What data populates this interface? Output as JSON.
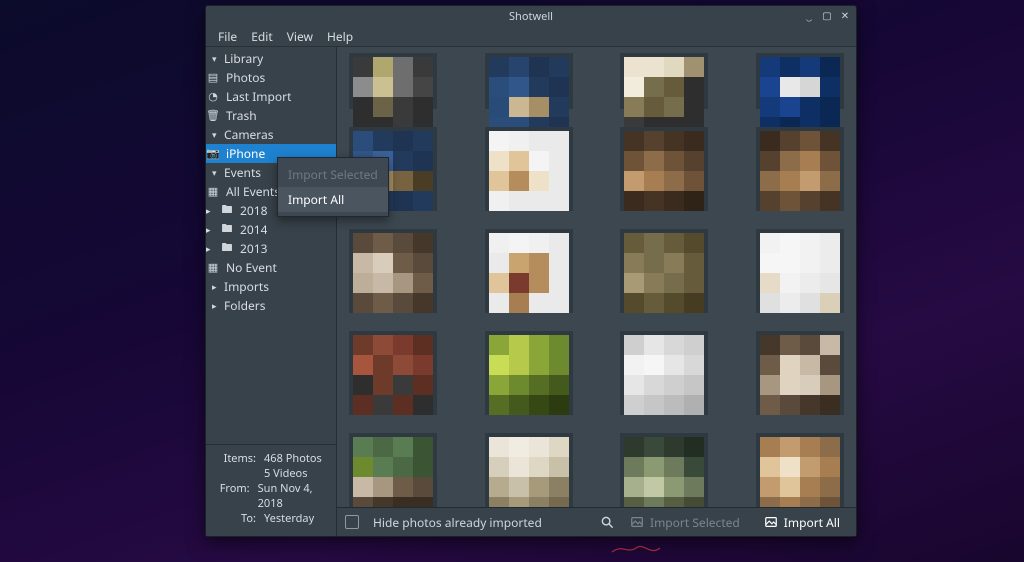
{
  "window": {
    "title": "Shotwell"
  },
  "menus": {
    "file": "File",
    "edit": "Edit",
    "view": "View",
    "help": "Help"
  },
  "tree": {
    "library": {
      "label": "Library",
      "photos": "Photos",
      "last_import": "Last Import",
      "trash": "Trash"
    },
    "cameras": {
      "label": "Cameras",
      "iphone": "iPhone"
    },
    "events": {
      "label": "Events",
      "all": "All Events",
      "y2018": "2018",
      "y2014": "2014",
      "y2013": "2013",
      "noevent": "No Event"
    },
    "imports": {
      "label": "Imports"
    },
    "folders": {
      "label": "Folders"
    }
  },
  "info": {
    "items_label": "Items:",
    "photos": "468 Photos",
    "videos": "5 Videos",
    "from_label": "From:",
    "from_value": "Sun Nov 4, 2018",
    "to_label": "To:",
    "to_value": "Yesterday"
  },
  "bottombar": {
    "hide_label": "Hide photos already imported",
    "import_selected": "Import Selected",
    "import_all": "Import All"
  },
  "context_menu": {
    "import_selected": "Import Selected",
    "import_all": "Import All"
  },
  "thumbs": [
    [
      [
        "#3a3a3a",
        "#b0a76f",
        "#6e6e6e",
        "#3a3a3a",
        "#8c8c8c",
        "#cac092",
        "#6e6e6e",
        "#454545",
        "#2e2e2e",
        "#6b6348",
        "#3a3a3a",
        "#2e2e2e",
        "#2e2e2e",
        "#2e2e2e",
        "#3a3a3a",
        "#2e2e2e"
      ],
      [
        "#223a5c",
        "#27446e",
        "#1e3452",
        "#223a5c",
        "#2a4d7c",
        "#315689",
        "#223a5c",
        "#1e3452",
        "#284b78",
        "#cbb792",
        "#a68f65",
        "#223a5c",
        "#2a4d7c",
        "#2a4d7c",
        "#223a5c",
        "#1e3452"
      ],
      [
        "#ebe3d0",
        "#ebe3d0",
        "#e1d8c0",
        "#a09270",
        "#f2ecdd",
        "#766d4c",
        "#665c3b",
        "#2e2e2e",
        "#887b58",
        "#665c3b",
        "#766d4c",
        "#2e2e2e",
        "#3a3a3a",
        "#2e2e2e",
        "#2e2e2e",
        "#2e2e2e"
      ],
      [
        "#153a7a",
        "#0e2f64",
        "#153a7a",
        "#0b2854",
        "#1a4490",
        "#e8e8e8",
        "#d6d6d6",
        "#0e2f64",
        "#153a7a",
        "#1a4490",
        "#0e2f64",
        "#0b2854",
        "#0e2f64",
        "#0b2854",
        "#0e2f64",
        "#0b2854"
      ]
    ],
    [
      [
        "#2a4d7c",
        "#223a5c",
        "#1e3452",
        "#223a5c",
        "#315689",
        "#3b629a",
        "#223a5c",
        "#1e3452",
        "#bfa976",
        "#a68f65",
        "#77633f",
        "#4a3d26",
        "#2a4d7c",
        "#223a5c",
        "#1e3452",
        "#223a5c"
      ],
      [
        "#f4f4f4",
        "#f0f0f0",
        "#eaeaea",
        "#eaeaea",
        "#efe1c8",
        "#e0c49a",
        "#f4f4f4",
        "#eaeaea",
        "#e0c49a",
        "#b58d5c",
        "#efe1c8",
        "#eaeaea",
        "#f0f0f0",
        "#eaeaea",
        "#eaeaea",
        "#eaeaea"
      ],
      [
        "#453324",
        "#56412e",
        "#453324",
        "#3a2b1e",
        "#6e5338",
        "#8d6c4a",
        "#6e5338",
        "#56412e",
        "#c29c6e",
        "#a67e52",
        "#8d6c4a",
        "#6e5338",
        "#3a2b1e",
        "#453324",
        "#3a2b1e",
        "#2f2318"
      ],
      [
        "#3a2b1e",
        "#56412e",
        "#6e5338",
        "#453324",
        "#56412e",
        "#8d6c4a",
        "#a67e52",
        "#6e5338",
        "#8d6c4a",
        "#a67e52",
        "#c29c6e",
        "#8d6c4a",
        "#56412e",
        "#6e5338",
        "#56412e",
        "#453324"
      ]
    ],
    [
      [
        "#5a4a3b",
        "#6e5b48",
        "#5a4a3b",
        "#453729",
        "#c7b9a6",
        "#d8ccba",
        "#6e5b48",
        "#5a4a3b",
        "#bdae99",
        "#c7b9a6",
        "#a79781",
        "#6e5b48",
        "#5a4a3b",
        "#6e5b48",
        "#5a4a3b",
        "#453729"
      ],
      [
        "#f0f0f0",
        "#f4f4f4",
        "#f0f0f0",
        "#eaeaea",
        "#eaeaea",
        "#c9a46e",
        "#b58d5c",
        "#eaeaea",
        "#e0c49a",
        "#7a3a2e",
        "#b58d5c",
        "#eaeaea",
        "#eaeaea",
        "#a67e52",
        "#eaeaea",
        "#eaeaea"
      ],
      [
        "#665c3b",
        "#766d4c",
        "#665c3b",
        "#544a2c",
        "#887b58",
        "#766d4c",
        "#887b58",
        "#665c3b",
        "#a79a74",
        "#887b58",
        "#766d4c",
        "#665c3b",
        "#544a2c",
        "#665c3b",
        "#544a2c",
        "#453c22"
      ],
      [
        "#f2f2f2",
        "#f6f6f6",
        "#f2f2f2",
        "#ececec",
        "#f6f6f6",
        "#f6f6f6",
        "#f2f2f2",
        "#ececec",
        "#e6dbc6",
        "#f2f2f2",
        "#ececec",
        "#e6e6e6",
        "#e0e0e0",
        "#ececec",
        "#e0e0e0",
        "#dad0b8"
      ]
    ],
    [
      [
        "#6e3a2a",
        "#8d4a36",
        "#7a3a2e",
        "#5c2f22",
        "#a7553c",
        "#6e3a2a",
        "#8d4a36",
        "#7a3a2e",
        "#2e2e2e",
        "#6e3a2a",
        "#3a3a3a",
        "#5c2f22",
        "#5c2f22",
        "#3a3a3a",
        "#5c2f22",
        "#2e2e2e"
      ],
      [
        "#8aa639",
        "#b7c94a",
        "#8aa639",
        "#6e8a2e",
        "#c9dc56",
        "#b7c94a",
        "#8aa639",
        "#6e8a2e",
        "#8aa639",
        "#6e8a2e",
        "#556e24",
        "#445a1d",
        "#556e24",
        "#445a1d",
        "#364914",
        "#2c3b10"
      ],
      [
        "#cfcfcf",
        "#e6e6e6",
        "#d8d8d8",
        "#cfcfcf",
        "#f2f2f2",
        "#f6f6f6",
        "#e6e6e6",
        "#d8d8d8",
        "#e6e6e6",
        "#d8d8d8",
        "#cfcfcf",
        "#c6c6c6",
        "#cfcfcf",
        "#c6c6c6",
        "#bcbcbc",
        "#b0b0b0"
      ],
      [
        "#453729",
        "#6e5b48",
        "#5a4a3b",
        "#c7b9a6",
        "#6e5b48",
        "#e0d3c0",
        "#c7b9a6",
        "#5a4a3b",
        "#a79781",
        "#e0d3c0",
        "#d8ccba",
        "#a79781",
        "#6e5b48",
        "#5a4a3b",
        "#453729",
        "#3a2e22"
      ]
    ],
    [
      [
        "#5a7c52",
        "#4a6944",
        "#5a7c52",
        "#3a5434",
        "#6e8a2e",
        "#5a7c52",
        "#4a6944",
        "#3a5434",
        "#c7b9a6",
        "#a79781",
        "#6e5b48",
        "#5a4a3b",
        "#5a4a3b",
        "#453729",
        "#3a2e22",
        "#3a2e22"
      ],
      [
        "#eae5d8",
        "#f0ece1",
        "#eae5d8",
        "#ded7c4",
        "#d6cfbc",
        "#eae5d8",
        "#ded7c4",
        "#c9c0aa",
        "#b7ab8f",
        "#c9c0aa",
        "#a79a7a",
        "#8c8064",
        "#8c8064",
        "#a79a7a",
        "#8c8064",
        "#756a50"
      ],
      [
        "#2e3a2e",
        "#3a4a3a",
        "#2e3a2e",
        "#232e23",
        "#6e7a5c",
        "#8c9a74",
        "#6e7a5c",
        "#3a4a3a",
        "#a7b08c",
        "#c0c8a4",
        "#8c9a74",
        "#6e7a5c",
        "#565e44",
        "#6e7a5c",
        "#565e44",
        "#454c36"
      ],
      [
        "#a67e52",
        "#c29c6e",
        "#a67e52",
        "#8d6c4a",
        "#e0c49a",
        "#efe1c8",
        "#c29c6e",
        "#a67e52",
        "#c29c6e",
        "#e0c49a",
        "#a67e52",
        "#8d6c4a",
        "#8d6c4a",
        "#a67e52",
        "#8d6c4a",
        "#6e5338"
      ]
    ]
  ]
}
